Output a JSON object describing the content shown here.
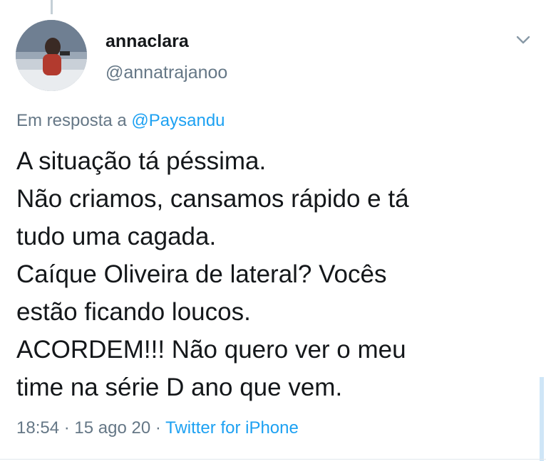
{
  "user": {
    "display_name": "annaclara",
    "handle": "@annatrajanoo"
  },
  "reply": {
    "prefix": "Em resposta a",
    "mention": "@Paysandu"
  },
  "tweet": {
    "lines": [
      "A situação tá péssima.",
      "Não criamos, cansamos rápido e tá",
      "tudo uma cagada.",
      "Caíque Oliveira de lateral? Vocês",
      "estão ficando loucos.",
      "ACORDEM!!! Não quero ver o meu",
      "time na série D ano que vem."
    ]
  },
  "meta": {
    "time": "18:54",
    "separator": "·",
    "date": "15 ago 20",
    "source": "Twitter for iPhone"
  },
  "icons": {
    "menu": "chevron-down-icon"
  },
  "colors": {
    "text": "#14171a",
    "secondary": "#657786",
    "accent": "#1da1f2"
  }
}
